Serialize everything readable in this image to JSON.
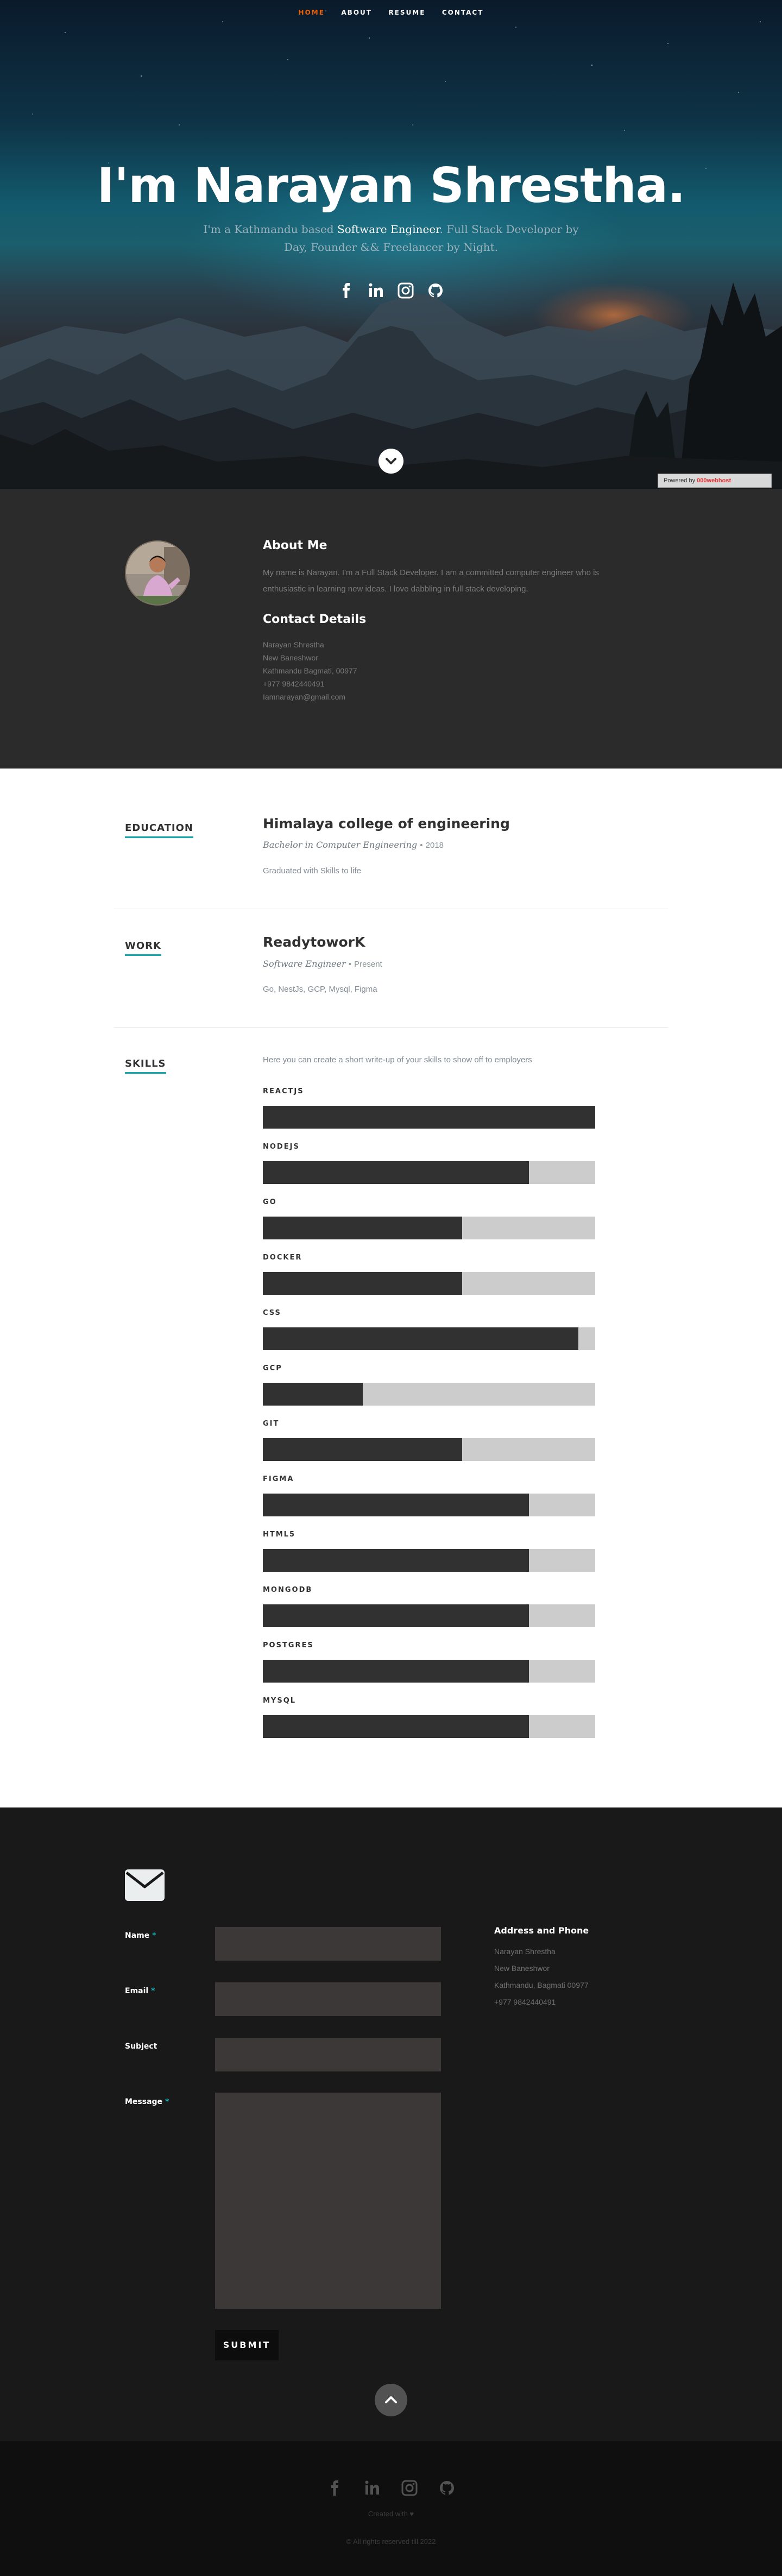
{
  "nav": {
    "items": [
      {
        "label": "HOME",
        "active": true
      },
      {
        "label": "ABOUT",
        "active": false
      },
      {
        "label": "RESUME",
        "active": false
      },
      {
        "label": "CONTACT",
        "active": false
      }
    ],
    "active_color": "#f06000"
  },
  "hero": {
    "title": "I'm Narayan Shrestha.",
    "subtitle_prefix": "I'm a Kathmandu based ",
    "subtitle_highlight": "Software Engineer",
    "subtitle_suffix": ". Full Stack Developer by Day, Founder && Freelancer by Night.",
    "social_icons": [
      "facebook-icon",
      "linkedin-icon",
      "instagram-icon",
      "github-icon"
    ],
    "powered_by": "Powered by",
    "powered_logo": "000webhost"
  },
  "about": {
    "heading": "About Me",
    "text": "My name is Narayan. I'm a Full Stack Developer. I am a committed computer engineer who is enthusiastic in learning new ideas. I love dabbling in full stack developing.",
    "contact_heading": "Contact Details",
    "contact": [
      "Narayan Shrestha",
      "New Baneshwor",
      "Kathmandu Bagmati, 00977",
      "+977 9842440491",
      "Iamnarayan@gmail.com"
    ]
  },
  "education": {
    "label": "EDUCATION",
    "school": "Himalaya college of engineering",
    "degree": "Bachelor in Computer Engineering",
    "bullet": "•",
    "year": "2018",
    "description": "Graduated with Skills to life"
  },
  "work": {
    "label": "WORK",
    "company": "ReadytoworK",
    "title": "Software Engineer",
    "bullet": "•",
    "years": "Present",
    "description": "Go, NestJs, GCP, Mysql, Figma"
  },
  "skills": {
    "label": "SKILLS",
    "intro": "Here you can create a short write-up of your skills to show off to employers",
    "items": [
      {
        "name": "REACTJS",
        "level": 100
      },
      {
        "name": "NODEJS",
        "level": 80
      },
      {
        "name": "GO",
        "level": 60
      },
      {
        "name": "DOCKER",
        "level": 60
      },
      {
        "name": "CSS",
        "level": 95
      },
      {
        "name": "GCP",
        "level": 30
      },
      {
        "name": "GIT",
        "level": 60
      },
      {
        "name": "FIGMA",
        "level": 80
      },
      {
        "name": "HTML5",
        "level": 80
      },
      {
        "name": "MONGODB",
        "level": 80
      },
      {
        "name": "POSTGRES",
        "level": 80
      },
      {
        "name": "MYSQL",
        "level": 80
      }
    ],
    "bar_color": "#313131",
    "track_color": "#cccccc"
  },
  "contact": {
    "fields": [
      {
        "label": "Name",
        "required": true
      },
      {
        "label": "Email",
        "required": true
      },
      {
        "label": "Subject",
        "required": false
      },
      {
        "label": "Message",
        "required": true
      }
    ],
    "required_mark": "*",
    "submit_label": "SUBMIT",
    "address_heading": "Address and Phone",
    "address": [
      "Narayan Shrestha",
      "New Baneshwor",
      "Kathmandu, Bagmati 00977",
      "+977 9842440491"
    ]
  },
  "footer": {
    "social_icons": [
      "facebook-icon",
      "linkedin-icon",
      "instagram-icon",
      "github-icon"
    ],
    "created": "Created with ♥",
    "copyright": "© All rights reserved till 2022"
  },
  "colors": {
    "accent": "#11abb0",
    "about_bg": "#2b2b2b",
    "contact_bg": "#191919",
    "footer_bg": "#0f0f0f"
  }
}
